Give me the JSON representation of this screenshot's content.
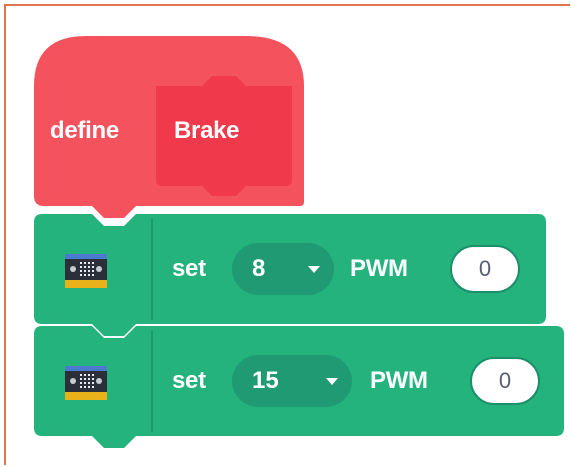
{
  "define_block": {
    "keyword": "define",
    "name": "Brake",
    "color": "#f4525d",
    "inner_color": "#f03a4b"
  },
  "blocks": [
    {
      "set_label": "set",
      "pin": "8",
      "pwm_label": "PWM",
      "value": "0"
    },
    {
      "set_label": "set",
      "pin": "15",
      "pwm_label": "PWM",
      "value": "0"
    }
  ],
  "colors": {
    "block_green": "#24b37d",
    "dropdown_green": "#1f9a72",
    "frame_border": "#e2734a"
  },
  "icons": {
    "microbit": "microbit-board-icon",
    "dropdown": "chevron-down-icon"
  }
}
